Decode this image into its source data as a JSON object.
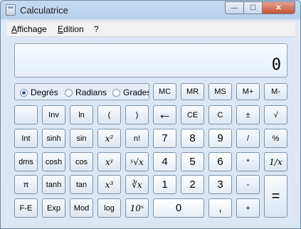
{
  "window": {
    "title": "Calculatrice"
  },
  "window_controls": {
    "minimize": "—",
    "maximize": "☐",
    "close": "✕"
  },
  "menu": [
    "Affichage",
    "Edition",
    "?"
  ],
  "display": {
    "value": "0"
  },
  "angle_modes": [
    {
      "label": "Degrés",
      "selected": true
    },
    {
      "label": "Radians",
      "selected": false
    },
    {
      "label": "Grades",
      "selected": false
    }
  ],
  "memory_keys": [
    "MC",
    "MR",
    "MS",
    "M+",
    "M-"
  ],
  "rows": [
    [
      "",
      "Inv",
      "ln",
      "(",
      ")",
      "←",
      "CE",
      "C",
      "±",
      "√"
    ],
    [
      "Int",
      "sinh",
      "sin",
      "x²",
      "n!",
      "7",
      "8",
      "9",
      "/",
      "%"
    ],
    [
      "dms",
      "cosh",
      "cos",
      "xʸ",
      "ʸ√x",
      "4",
      "5",
      "6",
      "*",
      "1/x"
    ],
    [
      "π",
      "tanh",
      "tan",
      "x³",
      "∛x",
      "1",
      "2",
      "3",
      "-",
      "="
    ],
    [
      "F-E",
      "Exp",
      "Mod",
      "log",
      "10ˣ",
      "0",
      ",",
      "+"
    ]
  ],
  "colors": {
    "frame": "#c6dbf1",
    "client": "#dbe7f4",
    "key_border": "#7d93ad",
    "close_button": "#c75033"
  }
}
